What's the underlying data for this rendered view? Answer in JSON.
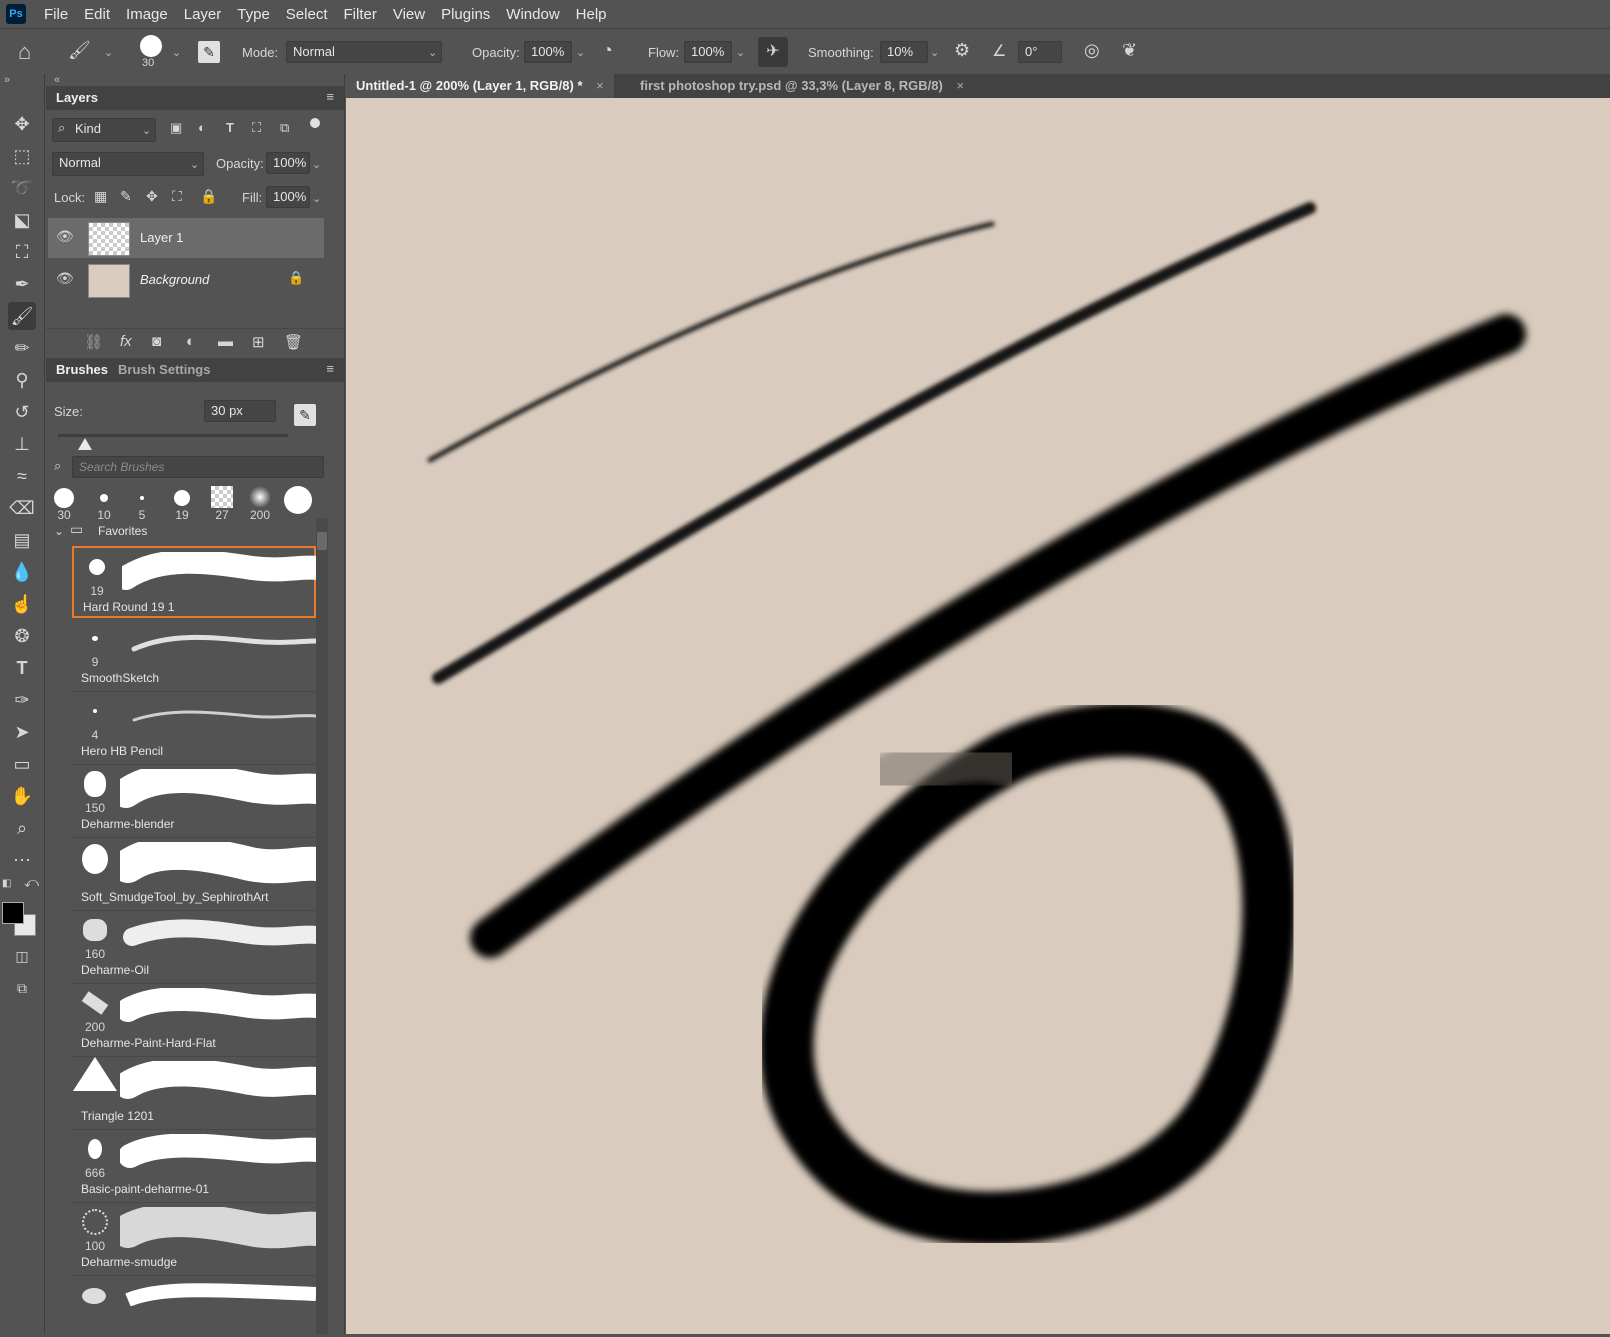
{
  "menubar": {
    "logo": "Ps",
    "items": [
      "File",
      "Edit",
      "Image",
      "Layer",
      "Type",
      "Select",
      "Filter",
      "View",
      "Plugins",
      "Window",
      "Help"
    ]
  },
  "options": {
    "brush_size": "30",
    "mode_label": "Mode:",
    "mode_value": "Normal",
    "opacity_label": "Opacity:",
    "opacity_value": "100%",
    "flow_label": "Flow:",
    "flow_value": "100%",
    "smoothing_label": "Smoothing:",
    "smoothing_value": "10%",
    "angle_value": "0°"
  },
  "tabs": [
    {
      "label": "Untitled-1 @ 200% (Layer 1, RGB/8) *",
      "active": true
    },
    {
      "label": "first photoshop try.psd @ 33,3% (Layer 8, RGB/8)",
      "active": false
    }
  ],
  "layers_panel": {
    "title": "Layers",
    "filter_label": "Kind",
    "blend_mode": "Normal",
    "opacity_label": "Opacity:",
    "opacity_value": "100%",
    "lock_label": "Lock:",
    "fill_label": "Fill:",
    "fill_value": "100%",
    "layers": [
      {
        "name": "Layer 1",
        "selected": true
      },
      {
        "name": "Background",
        "selected": false
      }
    ]
  },
  "brushes_panel": {
    "tab_brushes": "Brushes",
    "tab_settings": "Brush Settings",
    "size_label": "Size:",
    "size_value": "30 px",
    "search_placeholder": "Search Brushes",
    "presets": [
      "30",
      "10",
      "5",
      "19",
      "27",
      "200",
      ""
    ],
    "folder": "Favorites",
    "brushes": [
      {
        "size": "19",
        "name": "Hard Round 19 1"
      },
      {
        "size": "9",
        "name": "SmoothSketch"
      },
      {
        "size": "4",
        "name": "Hero HB Pencil"
      },
      {
        "size": "150",
        "name": "Deharme-blender"
      },
      {
        "size": "",
        "name": "Soft_SmudgeTool_by_SephirothArt"
      },
      {
        "size": "160",
        "name": "Deharme-Oil"
      },
      {
        "size": "200",
        "name": "Deharme-Paint-Hard-Flat"
      },
      {
        "size": "",
        "name": "Triangle 1201"
      },
      {
        "size": "666",
        "name": "Basic-paint-deharme-01"
      },
      {
        "size": "100",
        "name": "Deharme-smudge"
      }
    ]
  },
  "colors": {
    "canvas_bg": "#d9cbbd",
    "ui_bg": "#535353",
    "selection_accent": "#e8792d"
  }
}
